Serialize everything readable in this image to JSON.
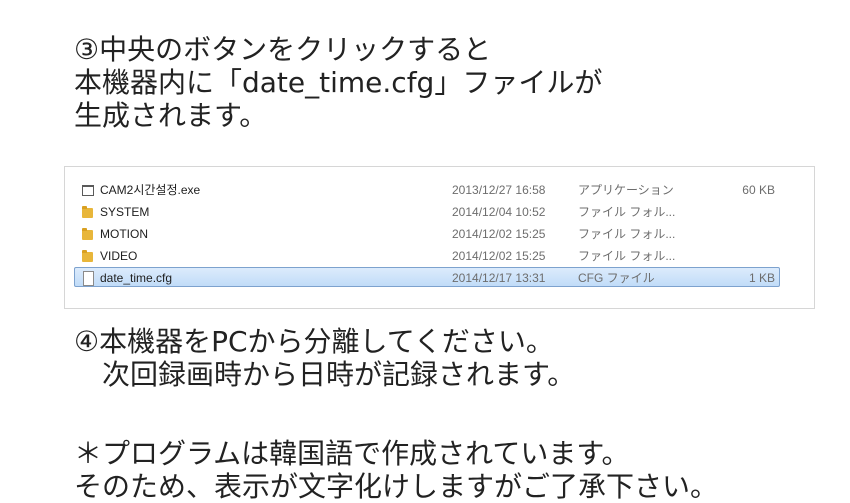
{
  "step3": {
    "line1": "③中央のボタンをクリックすると",
    "line2": "本機器内に「date_time.cfg」ファイルが",
    "line3": "生成されます。"
  },
  "file_list": {
    "rows": [
      {
        "name": "CAM2시간설정.exe",
        "date": "2013/12/27 16:58",
        "type": "アプリケーション",
        "size": "60 KB",
        "icon": "application-icon"
      },
      {
        "name": "SYSTEM",
        "date": "2014/12/04 10:52",
        "type": "ファイル フォル...",
        "size": "",
        "icon": "folder-icon"
      },
      {
        "name": "MOTION",
        "date": "2014/12/02 15:25",
        "type": "ファイル フォル...",
        "size": "",
        "icon": "folder-icon"
      },
      {
        "name": "VIDEO",
        "date": "2014/12/02 15:25",
        "type": "ファイル フォル...",
        "size": "",
        "icon": "folder-icon"
      },
      {
        "name": "date_time.cfg",
        "date": "2014/12/17 13:31",
        "type": "CFG ファイル",
        "size": "1 KB",
        "icon": "file-icon",
        "selected": true
      }
    ]
  },
  "step4": {
    "line1": "④本機器をPCから分離してください。",
    "line2": "次回録画時から日時が記録されます。"
  },
  "note": {
    "line1": "＊プログラムは韓国語で作成されています。",
    "line2": "そのため、表示が文字化けしますがご了承下さい。"
  }
}
